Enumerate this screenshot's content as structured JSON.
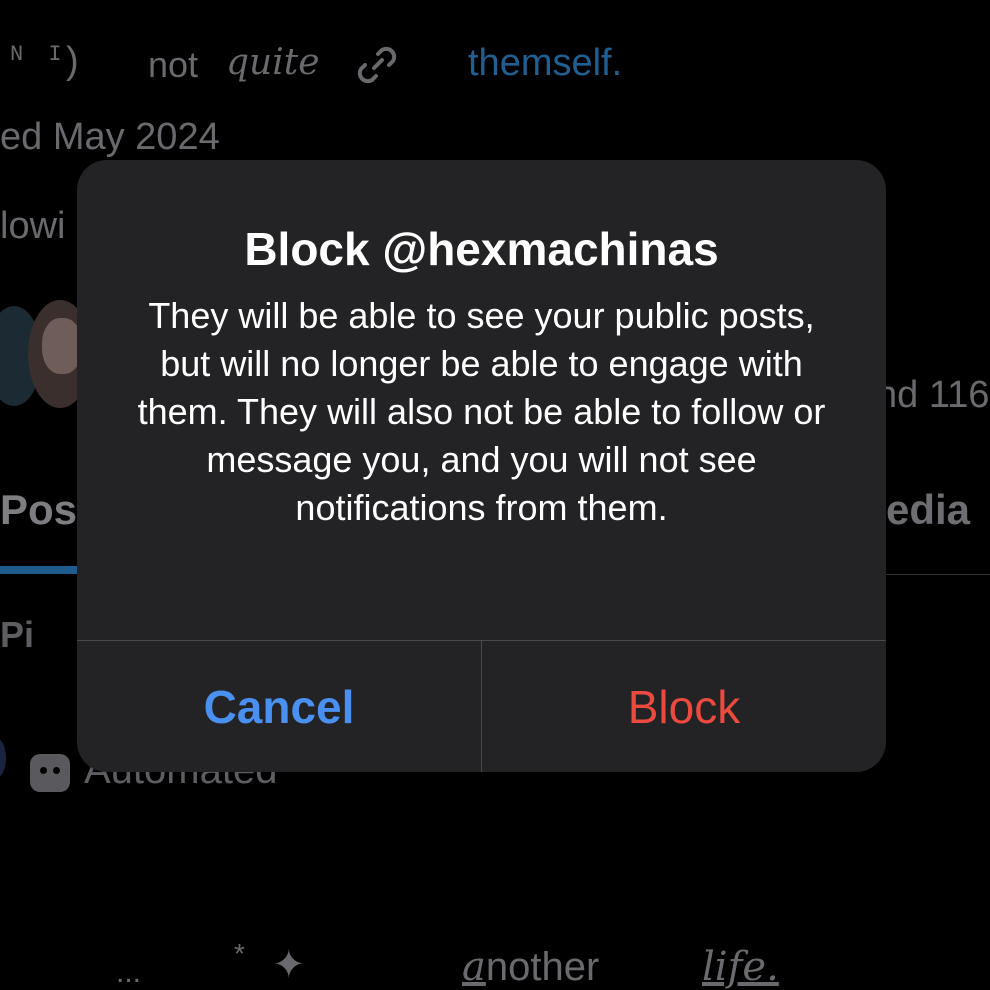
{
  "background": {
    "bio": {
      "mono_text": "N I",
      "paren": ")",
      "not_text": "not",
      "quite_text": "quite",
      "link_icon": "link-icon",
      "themself_text": "themself."
    },
    "joined_text": "ed May 2024",
    "following_text": "lowi",
    "followers_text": "nd 116",
    "tabs": {
      "posts_label": "Pos",
      "media_label": "edia"
    },
    "pinned_text": "Pi",
    "automated_text": "Automated",
    "footer": {
      "ellipsis": "...",
      "asterisk": "*",
      "sparkle": "✦",
      "another_a": "a",
      "another_rest": "nother",
      "life": "life."
    }
  },
  "dialog": {
    "title": "Block @hexmachinas",
    "message": "They will be able to see your public posts, but will no longer be able to engage with them. They will also not be able to follow or message you, and you will not see notifications from them.",
    "cancel_label": "Cancel",
    "block_label": "Block"
  },
  "colors": {
    "cancel": "#4a90f0",
    "block": "#ec4a3f",
    "dialog_bg": "#232325",
    "link_blue": "#1f5f92"
  }
}
